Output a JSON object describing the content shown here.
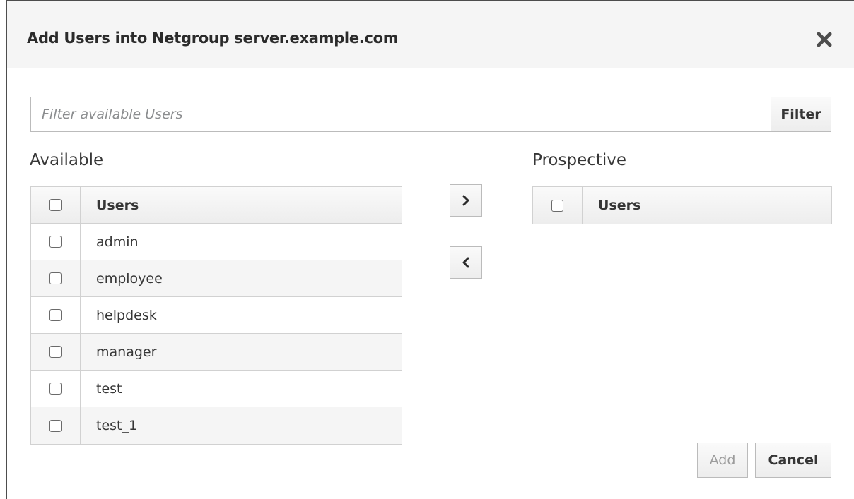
{
  "dialog": {
    "title": "Add Users into Netgroup server.example.com",
    "close_icon": "close-icon"
  },
  "filter": {
    "placeholder": "Filter available Users",
    "value": "",
    "button_label": "Filter"
  },
  "available": {
    "label": "Available",
    "column_header": "Users",
    "rows": [
      "admin",
      "employee",
      "helpdesk",
      "manager",
      "test",
      "test_1"
    ]
  },
  "prospective": {
    "label": "Prospective",
    "column_header": "Users",
    "rows": []
  },
  "move_buttons": {
    "add_icon": "chevron-right-icon",
    "remove_icon": "chevron-left-icon"
  },
  "footer": {
    "add_label": "Add",
    "cancel_label": "Cancel"
  },
  "colors": {
    "header_bg": "#f5f5f5",
    "alt_row_bg": "#f5f5f5",
    "border": "#d1d1d1",
    "disabled_text": "#9c9c9c"
  }
}
